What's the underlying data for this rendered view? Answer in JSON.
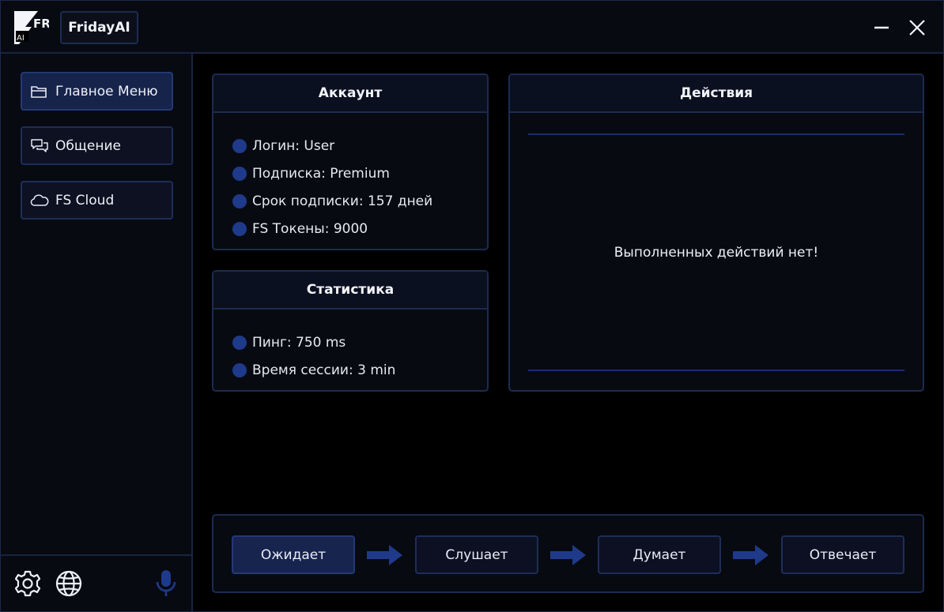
{
  "app": {
    "title": "FridayAI",
    "logo_text": "FR",
    "logo_sub": "AI"
  },
  "sidebar": {
    "items": [
      {
        "label": "Главное Меню",
        "icon": "folder-icon"
      },
      {
        "label": "Общение",
        "icon": "chat-icon"
      },
      {
        "label": "FS Cloud",
        "icon": "cloud-icon"
      }
    ],
    "bottom_icons": [
      "gear-icon",
      "globe-icon",
      "microphone-icon"
    ]
  },
  "account": {
    "title": "Аккаунт",
    "items": [
      "Логин: User",
      "Подписка: Premium",
      "Срок подписки: 157 дней",
      "FS Токены: 9000"
    ]
  },
  "stats": {
    "title": "Статистика",
    "items": [
      "Пинг: 750 ms",
      "Время сессии: 3 min"
    ]
  },
  "actions": {
    "title": "Действия",
    "empty_text": "Выполненных действий нет!"
  },
  "status": {
    "steps": [
      "Ожидает",
      "Слушает",
      "Думает",
      "Отвечает"
    ],
    "active_index": 0
  },
  "colors": {
    "accent": "#1f3a8a",
    "panel_border": "#1c2b50",
    "background": "#000000"
  }
}
